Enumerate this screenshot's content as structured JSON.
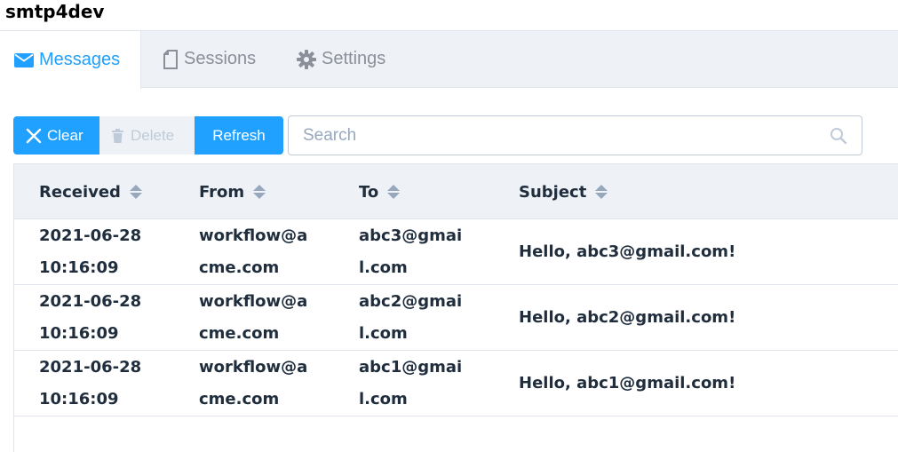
{
  "app": {
    "title": "smtp4dev"
  },
  "tabs": [
    {
      "label": "Messages",
      "icon": "envelope-icon",
      "active": true
    },
    {
      "label": "Sessions",
      "icon": "document-icon",
      "active": false
    },
    {
      "label": "Settings",
      "icon": "gear-icon",
      "active": false
    }
  ],
  "toolbar": {
    "clear_label": "Clear",
    "delete_label": "Delete",
    "refresh_label": "Refresh",
    "search_placeholder": "Search"
  },
  "table": {
    "columns": [
      "Received",
      "From",
      "To",
      "Subject"
    ],
    "rows": [
      {
        "received_date": "2021-06-28",
        "received_time": "10:16:09",
        "from_1": "workflow@a",
        "from_2": "cme.com",
        "to_1": "abc3@gmai",
        "to_2": "l.com",
        "subject": "Hello, abc3@gmail.com!"
      },
      {
        "received_date": "2021-06-28",
        "received_time": "10:16:09",
        "from_1": "workflow@a",
        "from_2": "cme.com",
        "to_1": "abc2@gmai",
        "to_2": "l.com",
        "subject": "Hello, abc2@gmail.com!"
      },
      {
        "received_date": "2021-06-28",
        "received_time": "10:16:09",
        "from_1": "workflow@a",
        "from_2": "cme.com",
        "to_1": "abc1@gmai",
        "to_2": "l.com",
        "subject": "Hello, abc1@gmail.com!"
      }
    ]
  },
  "colors": {
    "accent": "#20a0ff",
    "header_bg": "#eef1f6",
    "border": "#dfe4ed",
    "disabled": "#bfcbd9"
  }
}
